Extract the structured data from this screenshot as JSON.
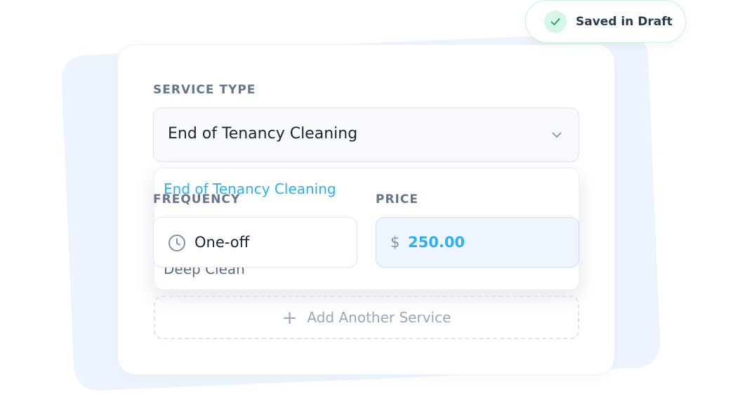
{
  "service": {
    "label": "SERVICE TYPE",
    "selected_value": "End of Tenancy Cleaning",
    "options": [
      "End of Tenancy Cleaning",
      "Deep Clean"
    ]
  },
  "frequency": {
    "label": "FREQUENCY",
    "value": "One-off"
  },
  "price": {
    "label": "PRICE",
    "currency": "$",
    "value": "250.00"
  },
  "add_service": {
    "plus": "+",
    "label": "Add Another Service"
  },
  "status_badge": {
    "text": "Saved in Draft"
  },
  "icons": {
    "select": "chevron-down-icon",
    "frequency": "clock-icon",
    "status": "check-icon"
  },
  "colors": {
    "accent": "#2bb2ee",
    "success_bg": "#d8f6e5",
    "success": "#1f9d5a"
  }
}
